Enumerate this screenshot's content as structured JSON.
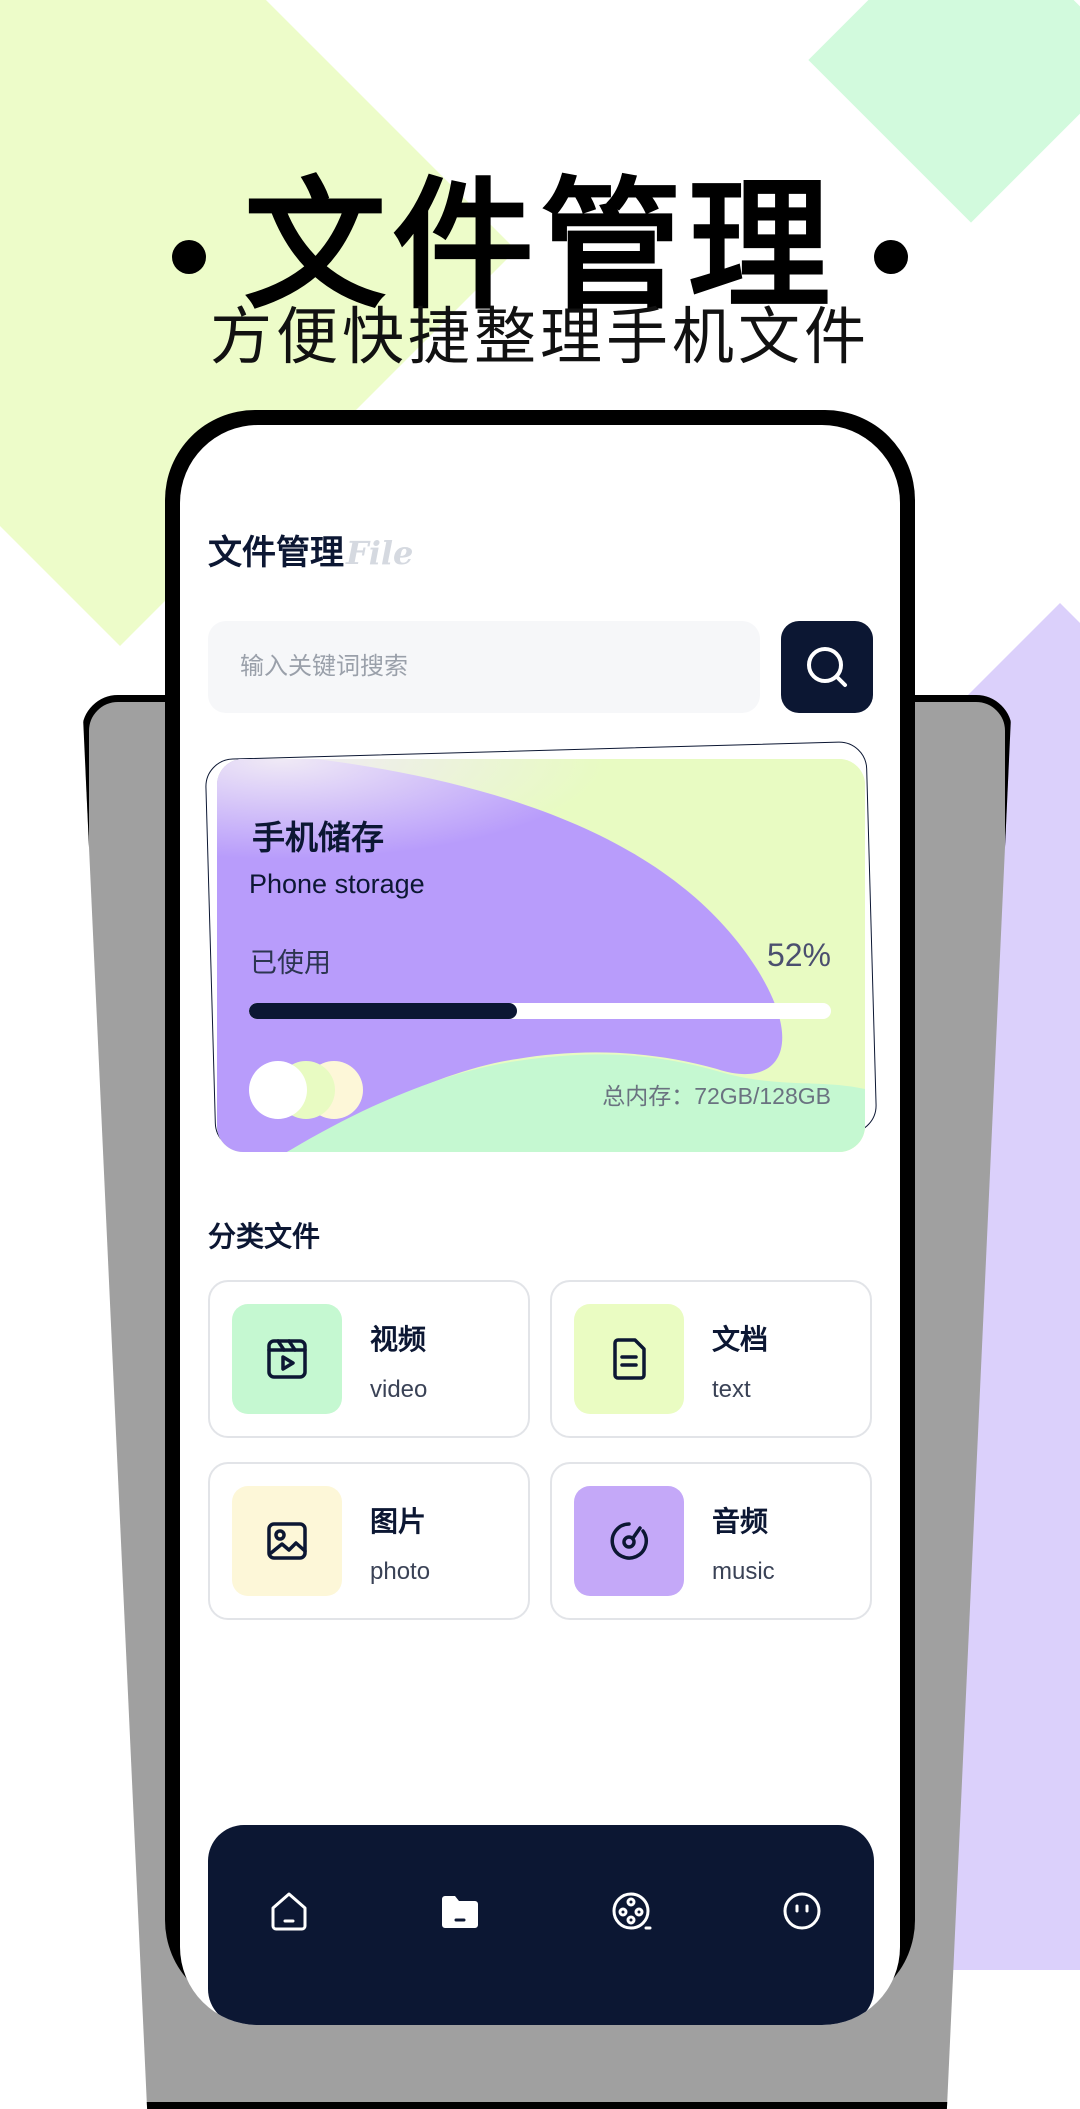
{
  "promo": {
    "headline": "文件管理",
    "subline": "方便快捷整理手机文件"
  },
  "app": {
    "title": "文件管理",
    "title_decoration": "File"
  },
  "search": {
    "placeholder": "输入关键词搜索",
    "button_icon": "search-icon"
  },
  "storage_card": {
    "title": "手机储存",
    "subtitle": "Phone storage",
    "used_label": "已使用",
    "used_percent_text": "52%",
    "used_fraction": 0.46,
    "total_text": "总内存：72GB/128GB"
  },
  "categories": {
    "section_title": "分类文件",
    "items": [
      {
        "cn": "视频",
        "en": "video",
        "icon": "video-icon",
        "color": "#c5f8d1"
      },
      {
        "cn": "文档",
        "en": "text",
        "icon": "document-icon",
        "color": "#eafcc2"
      },
      {
        "cn": "图片",
        "en": "photo",
        "icon": "image-icon",
        "color": "#fdf7d8"
      },
      {
        "cn": "音频",
        "en": "music",
        "icon": "music-icon",
        "color": "#c4a8f8"
      }
    ]
  },
  "tabbar": {
    "items": [
      {
        "icon": "home-icon",
        "active": false
      },
      {
        "icon": "folder-icon",
        "active": true
      },
      {
        "icon": "film-reel-icon",
        "active": false
      },
      {
        "icon": "face-icon",
        "active": false
      }
    ]
  },
  "colors": {
    "navy": "#0c1733",
    "lime": "#edfcc9",
    "mint": "#d2fadd",
    "lavender": "#dbd0fb",
    "purple": "#b89cfb"
  }
}
